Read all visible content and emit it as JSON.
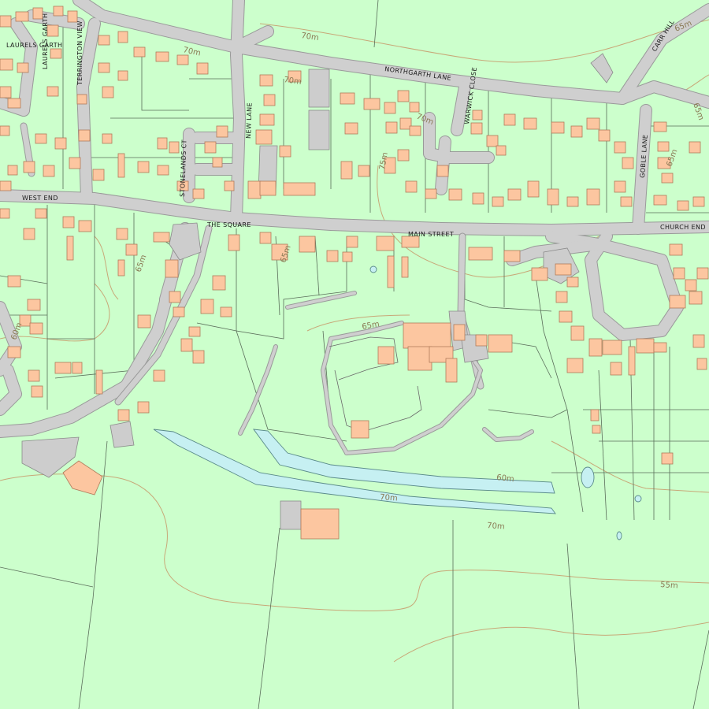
{
  "map": {
    "colors": {
      "land": "#ccffcc",
      "road": "#cfcfcf",
      "road_edge": "#9a9a9a",
      "building": "#fcc6a0",
      "building_edge": "#b07a5a",
      "water": "#c6f0f2",
      "water_edge": "#5a8a8a",
      "grey_area": "#cdcdcd",
      "parcel_line": "#5a6e5a",
      "contour": "#c8a878"
    },
    "street_labels": {
      "laurels_garth": "LAURELS GARTH",
      "laurels_garth_short": "LAURELS GARTH",
      "terrington_view": "TERRINGTON VIEW",
      "northgarth_lane": "NORTHGARTH LANE",
      "warwick_close": "WARWICK CLOSE",
      "new_lane": "NEW LANE",
      "stonelands_ct": "STONELANDS CT",
      "west_end": "WEST END",
      "the_square": "THE SQUARE",
      "main_street": "MAIN STREET",
      "church_end": "CHURCH END",
      "goble_lane": "GOBLE LANE",
      "carrhill": "CARR HILL"
    },
    "contour_labels": {
      "c70_top": "70m",
      "c70_stone": "70m",
      "c70_nl": "70m",
      "c70_warwick": "70m",
      "c65_top": "65m",
      "c65_right": "65m",
      "c65_goble": "65m",
      "c75": "75m",
      "c65_mid": "65m",
      "c65_left": "65m",
      "c60_left": "60m",
      "c65_castle": "65m",
      "c60_pond": "60m",
      "c70_pond": "70m",
      "c70_south": "70m",
      "c55": "55m"
    }
  }
}
